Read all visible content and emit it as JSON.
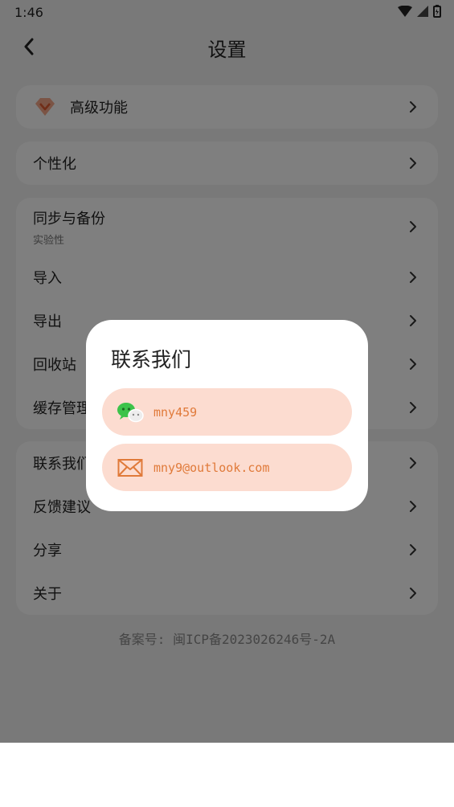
{
  "status_bar": {
    "time": "1:46"
  },
  "header": {
    "title": "设置"
  },
  "sections": {
    "premium": {
      "label": "高级功能"
    },
    "personalize": {
      "label": "个性化"
    },
    "data": [
      {
        "label": "同步与备份",
        "sub": "实验性"
      },
      {
        "label": "导入"
      },
      {
        "label": "导出"
      },
      {
        "label": "回收站"
      },
      {
        "label": "缓存管理"
      }
    ],
    "misc": [
      {
        "label": "联系我们"
      },
      {
        "label": "反馈建议"
      },
      {
        "label": "分享"
      },
      {
        "label": "关于"
      }
    ]
  },
  "footer": {
    "icp": "备案号: 闽ICP备2023026246号-2A"
  },
  "dialog": {
    "title": "联系我们",
    "wechat": "mny459",
    "email": "mny9@outlook.com"
  },
  "colors": {
    "accent": "#e07a3a",
    "pill": "#fcdcd0",
    "gem": "#f2825a"
  }
}
